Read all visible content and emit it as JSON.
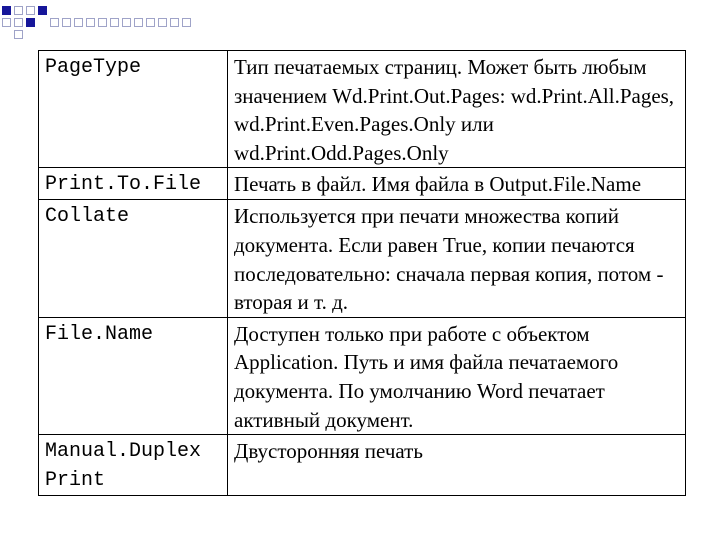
{
  "decor_colors": {
    "filled": "#16169a",
    "outline": "#9fa3c8"
  },
  "table": {
    "rows": [
      {
        "name": "PageType",
        "description": "Тип печатаемых страниц. Может быть любым значением Wd.Print.Out.Pages: wd.Print.All.Pages, wd.Print.Even.Pages.Only или wd.Print.Odd.Pages.Only"
      },
      {
        "name": "Print.To.File",
        "description": "Печать в файл. Имя файла в Output.File.Name"
      },
      {
        "name": "Collate",
        "description": "Используется при печати множества копий документа. Если равен True, копии печаются последовательно: сначала первая копия, потом - вторая и т. д."
      },
      {
        "name": "File.Name",
        "description": "Доступен только при работе с объектом Application. Путь и имя файла печатаемого документа. По умолчанию Word печатает активный документ."
      },
      {
        "name": "Manual.Duplex\nPrint",
        "description": "Двусторонняя печать"
      }
    ]
  }
}
